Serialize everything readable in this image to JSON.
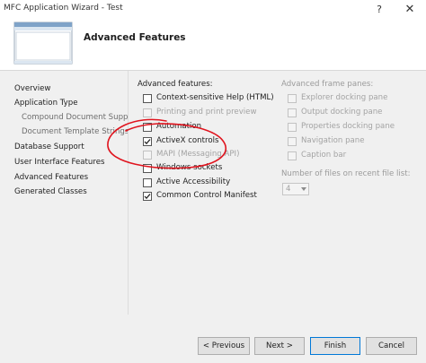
{
  "window": {
    "title": "MFC Application Wizard - Test",
    "help_label": "?",
    "close_label": "✕"
  },
  "header": {
    "title": "Advanced Features"
  },
  "nav": {
    "items": [
      {
        "label": "Overview"
      },
      {
        "label": "Application Type"
      },
      {
        "label": "Compound Document Support"
      },
      {
        "label": "Document Template Strings"
      },
      {
        "label": "Database Support"
      },
      {
        "label": "User Interface Features"
      },
      {
        "label": "Advanced Features"
      },
      {
        "label": "Generated Classes"
      }
    ]
  },
  "advanced_features": {
    "label": "Advanced features:",
    "options": [
      {
        "label": "Context-sensitive Help (HTML)",
        "checked": false,
        "enabled": true
      },
      {
        "label": "Printing and print preview",
        "checked": false,
        "enabled": false
      },
      {
        "label": "Automation",
        "checked": false,
        "enabled": true
      },
      {
        "label": "ActiveX controls",
        "checked": true,
        "enabled": true
      },
      {
        "label": "MAPI (Messaging API)",
        "checked": false,
        "enabled": false
      },
      {
        "label": "Windows sockets",
        "checked": false,
        "enabled": true
      },
      {
        "label": "Active Accessibility",
        "checked": false,
        "enabled": true
      },
      {
        "label": "Common Control Manifest",
        "checked": true,
        "enabled": true
      }
    ]
  },
  "frame_panes": {
    "label": "Advanced frame panes:",
    "options": [
      {
        "label": "Explorer docking pane",
        "checked": false,
        "enabled": false
      },
      {
        "label": "Output docking pane",
        "checked": false,
        "enabled": false
      },
      {
        "label": "Properties docking pane",
        "checked": false,
        "enabled": false
      },
      {
        "label": "Navigation pane",
        "checked": false,
        "enabled": false
      },
      {
        "label": "Caption bar",
        "checked": false,
        "enabled": false
      }
    ]
  },
  "recent_files": {
    "label": "Number of files on recent file list:",
    "value": "4"
  },
  "buttons": {
    "previous": "< Previous",
    "next": "Next >",
    "finish": "Finish",
    "cancel": "Cancel"
  },
  "colors": {
    "annotation_circle": "#e0141e",
    "primary_border": "#0078d7"
  }
}
